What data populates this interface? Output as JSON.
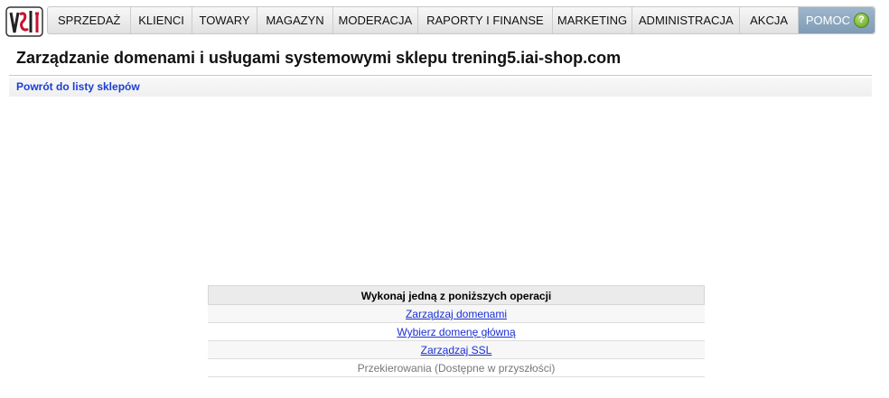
{
  "nav": {
    "items": [
      {
        "label": "SPRZEDAŻ"
      },
      {
        "label": "KLIENCI"
      },
      {
        "label": "TOWARY"
      },
      {
        "label": "MAGAZYN"
      },
      {
        "label": "MODERACJA"
      },
      {
        "label": "RAPORTY I FINANSE"
      },
      {
        "label": "MARKETING"
      },
      {
        "label": "ADMINISTRACJA"
      },
      {
        "label": "AKCJA"
      }
    ],
    "help_label": "POMOC",
    "help_icon": "help-icon"
  },
  "header": {
    "title": "Zarządzanie domenami i usługami systemowymi sklepu trening5.iai-shop.com",
    "back_link": "Powrót do listy sklepów"
  },
  "operations": {
    "heading": "Wykonaj jedną z poniższych operacji",
    "links": [
      {
        "label": "Zarządzaj domenami"
      },
      {
        "label": "Wybierz domenę główną"
      },
      {
        "label": "Zarządzaj SSL"
      }
    ],
    "disabled_item": "Przekierowania (Dostępne w przyszłości)"
  },
  "colors": {
    "link": "#1a2fd4",
    "help_bg": "#8ea8c1",
    "help_icon": "#6aab27"
  }
}
